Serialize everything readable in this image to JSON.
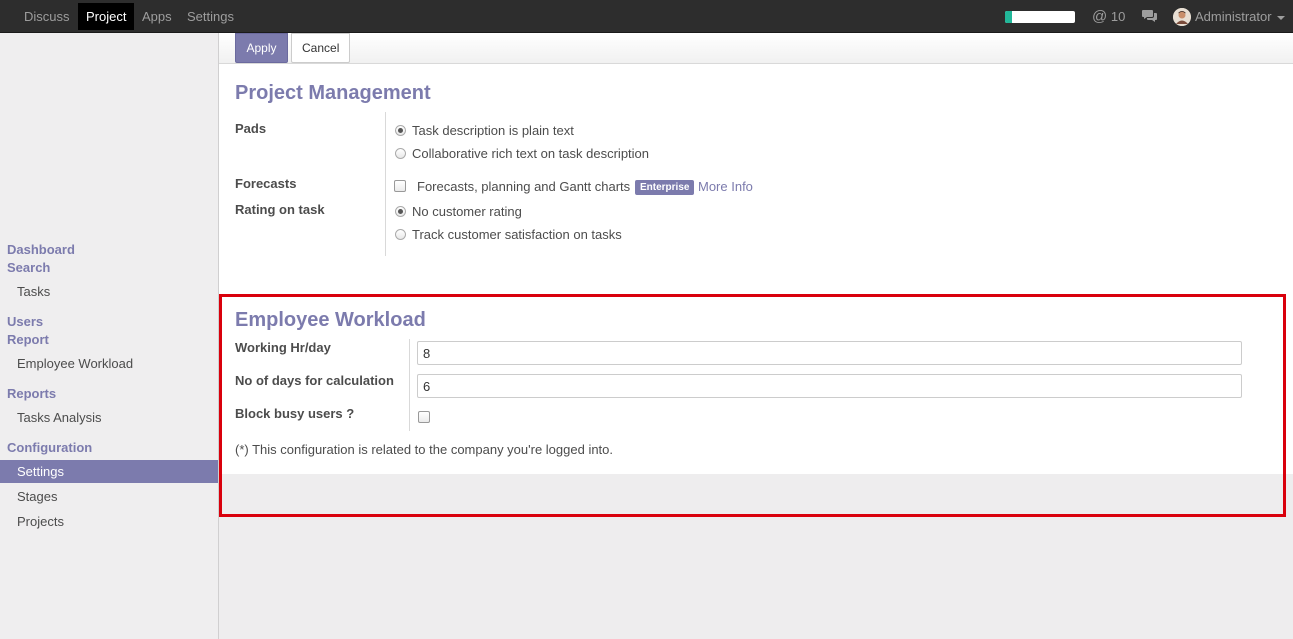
{
  "topbar": {
    "menu": [
      "Discuss",
      "Project",
      "Apps",
      "Settings"
    ],
    "active_menu": "Project",
    "progress": 0.1,
    "mentions_count": "10",
    "user_name": "Administrator",
    "icons": [
      "at-icon",
      "chat-icon",
      "avatar",
      "caret-down-icon"
    ]
  },
  "sidebar": {
    "cat_dashboard": "Dashboard",
    "cat_search": "Search",
    "tasks": "Tasks",
    "cat_users": "Users",
    "cat_report": "Report",
    "employee_workload": "Employee Workload",
    "cat_reports": "Reports",
    "tasks_analysis": "Tasks Analysis",
    "cat_configuration": "Configuration",
    "settings": "Settings",
    "stages": "Stages",
    "projects": "Projects"
  },
  "control_panel": {
    "apply": "Apply",
    "cancel": "Cancel"
  },
  "project_management": {
    "title": "Project Management",
    "pads_label": "Pads",
    "pads_opt1": "Task description is plain text",
    "pads_opt2": "Collaborative rich text on task description",
    "pads_selected": 1,
    "forecasts_label": "Forecasts",
    "forecasts_opt": "Forecasts, planning and Gantt charts",
    "forecasts_checked": false,
    "enterprise_badge": "Enterprise",
    "more_info": "More Info",
    "rating_label": "Rating on task",
    "rating_opt1": "No customer rating",
    "rating_opt2": "Track customer satisfaction on tasks",
    "rating_selected": 1
  },
  "employee_workload": {
    "title": "Employee Workload",
    "working_hr_label": "Working Hr/day",
    "working_hr_value": "8",
    "days_label": "No of days for calculation",
    "days_value": "6",
    "block_label": "Block busy users ?",
    "block_checked": false,
    "note": "(*) This configuration is related to the company you're logged into."
  },
  "colors": {
    "accent": "#7c7bad",
    "highlight_border": "#d9000c",
    "progress": "#21b799"
  }
}
